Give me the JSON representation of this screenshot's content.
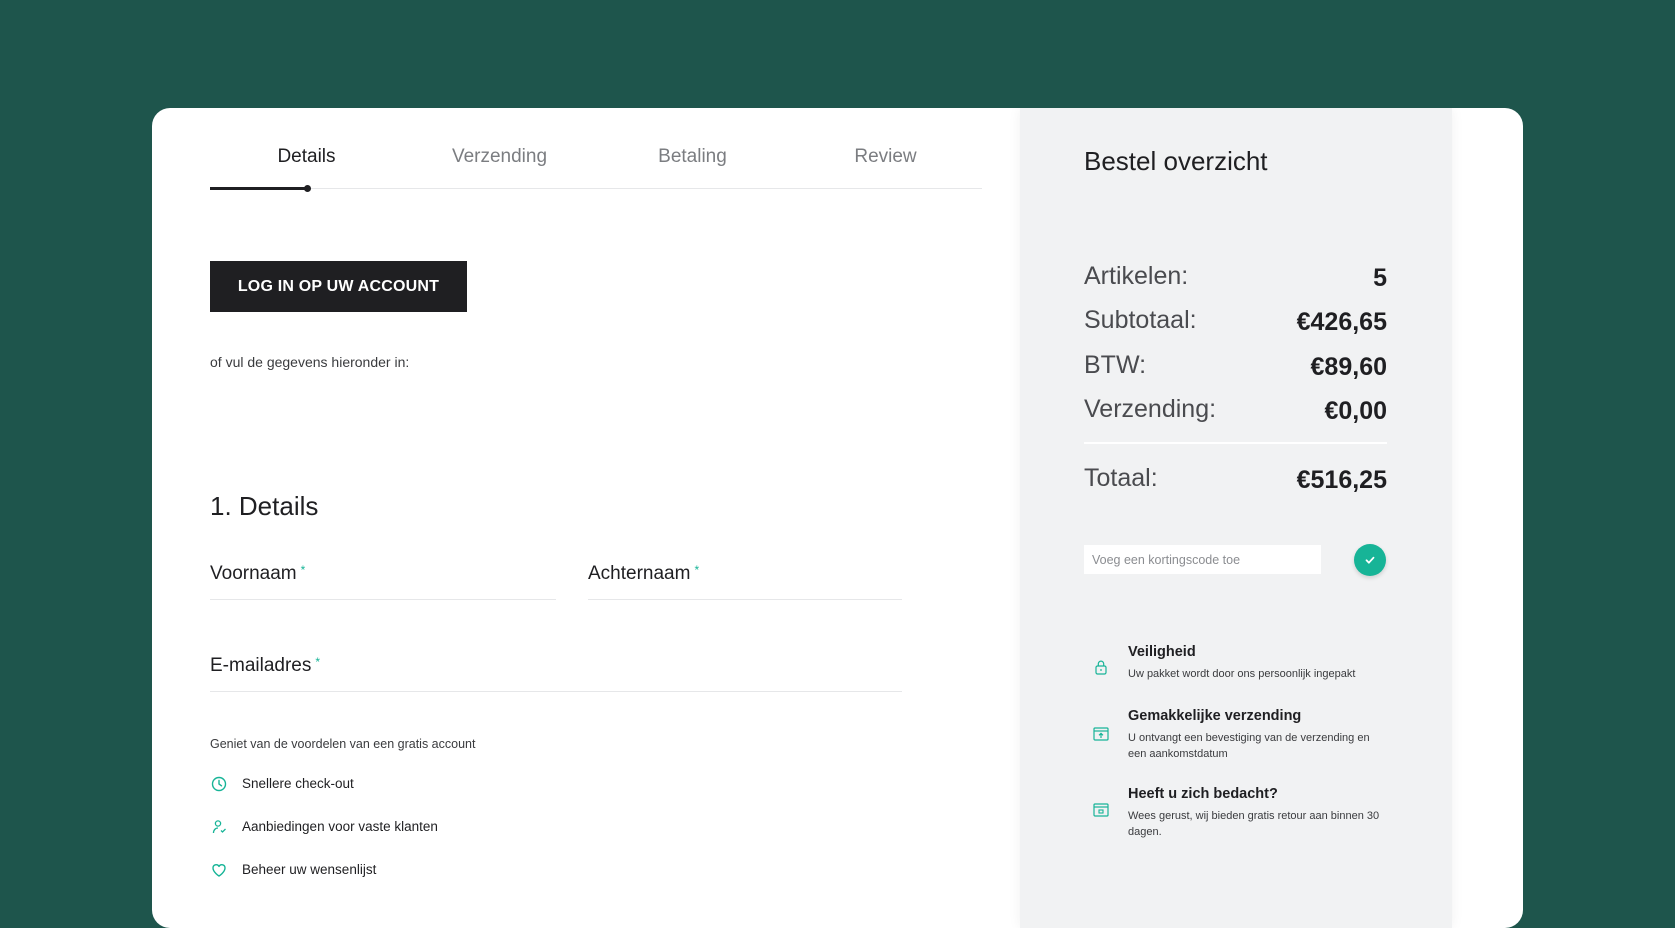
{
  "tabs": [
    "Details",
    "Verzending",
    "Betaling",
    "Review"
  ],
  "active_tab_index": 0,
  "login_button": "LOG IN OP UW ACCOUNT",
  "or_text": "of vul de gegevens hieronder in:",
  "section_title": "1. Details",
  "form": {
    "first_name": "Voornaam",
    "last_name": "Achternaam",
    "email": "E-mailadres",
    "required_mark": "*"
  },
  "benefits_intro": "Geniet van de voordelen van een gratis account",
  "benefits": [
    {
      "icon": "clock-icon",
      "label": "Snellere check-out"
    },
    {
      "icon": "person-icon",
      "label": "Aanbiedingen voor vaste klanten"
    },
    {
      "icon": "heart-icon",
      "label": "Beheer uw wensenlijst"
    }
  ],
  "summary": {
    "title": "Bestel overzicht",
    "rows": [
      {
        "label": "Artikelen:",
        "value": "5"
      },
      {
        "label": "Subtotaal:",
        "value": "€426,65"
      },
      {
        "label": "BTW:",
        "value": "€89,60"
      },
      {
        "label": "Verzending:",
        "value": "€0,00"
      }
    ],
    "total": {
      "label": "Totaal:",
      "value": "€516,25"
    },
    "coupon_placeholder": "Voeg een kortingscode toe"
  },
  "features": [
    {
      "icon": "lock-icon",
      "title": "Veiligheid",
      "desc": "Uw pakket wordt door ons persoonlijk ingepakt"
    },
    {
      "icon": "box-upload-icon",
      "title": "Gemakkelijke verzending",
      "desc": "U ontvangt een bevestiging van de verzending en een aankomstdatum"
    },
    {
      "icon": "box-return-icon",
      "title": "Heeft u zich bedacht?",
      "desc": "Wees gerust, wij bieden gratis retour aan binnen 30 dagen."
    }
  ],
  "colors": {
    "background": "#1e554c",
    "accent": "#17b497",
    "dark": "#1f1f22",
    "panel": "#f1f2f3"
  }
}
